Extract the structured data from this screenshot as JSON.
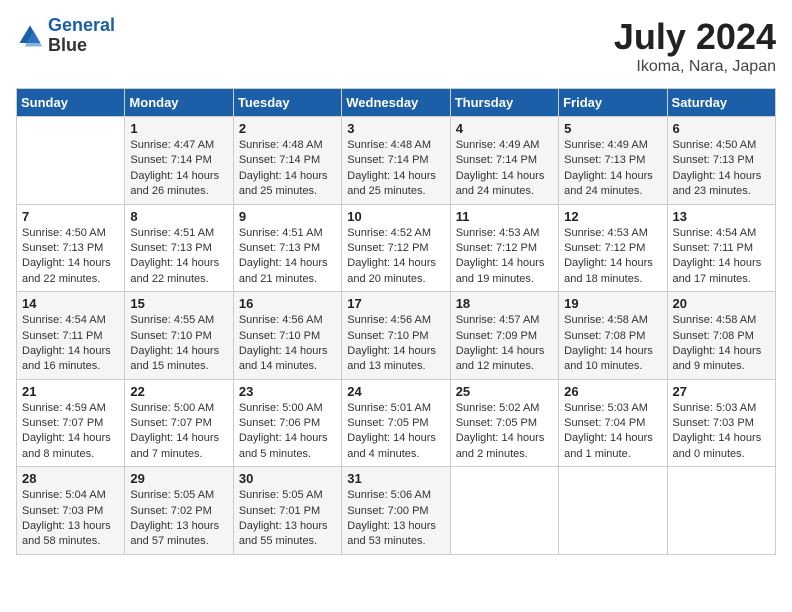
{
  "logo": {
    "line1": "General",
    "line2": "Blue"
  },
  "title": "July 2024",
  "subtitle": "Ikoma, Nara, Japan",
  "days_header": [
    "Sunday",
    "Monday",
    "Tuesday",
    "Wednesday",
    "Thursday",
    "Friday",
    "Saturday"
  ],
  "weeks": [
    [
      {
        "day": "",
        "info": ""
      },
      {
        "day": "1",
        "info": "Sunrise: 4:47 AM\nSunset: 7:14 PM\nDaylight: 14 hours\nand 26 minutes."
      },
      {
        "day": "2",
        "info": "Sunrise: 4:48 AM\nSunset: 7:14 PM\nDaylight: 14 hours\nand 25 minutes."
      },
      {
        "day": "3",
        "info": "Sunrise: 4:48 AM\nSunset: 7:14 PM\nDaylight: 14 hours\nand 25 minutes."
      },
      {
        "day": "4",
        "info": "Sunrise: 4:49 AM\nSunset: 7:14 PM\nDaylight: 14 hours\nand 24 minutes."
      },
      {
        "day": "5",
        "info": "Sunrise: 4:49 AM\nSunset: 7:13 PM\nDaylight: 14 hours\nand 24 minutes."
      },
      {
        "day": "6",
        "info": "Sunrise: 4:50 AM\nSunset: 7:13 PM\nDaylight: 14 hours\nand 23 minutes."
      }
    ],
    [
      {
        "day": "7",
        "info": "Sunrise: 4:50 AM\nSunset: 7:13 PM\nDaylight: 14 hours\nand 22 minutes."
      },
      {
        "day": "8",
        "info": "Sunrise: 4:51 AM\nSunset: 7:13 PM\nDaylight: 14 hours\nand 22 minutes."
      },
      {
        "day": "9",
        "info": "Sunrise: 4:51 AM\nSunset: 7:13 PM\nDaylight: 14 hours\nand 21 minutes."
      },
      {
        "day": "10",
        "info": "Sunrise: 4:52 AM\nSunset: 7:12 PM\nDaylight: 14 hours\nand 20 minutes."
      },
      {
        "day": "11",
        "info": "Sunrise: 4:53 AM\nSunset: 7:12 PM\nDaylight: 14 hours\nand 19 minutes."
      },
      {
        "day": "12",
        "info": "Sunrise: 4:53 AM\nSunset: 7:12 PM\nDaylight: 14 hours\nand 18 minutes."
      },
      {
        "day": "13",
        "info": "Sunrise: 4:54 AM\nSunset: 7:11 PM\nDaylight: 14 hours\nand 17 minutes."
      }
    ],
    [
      {
        "day": "14",
        "info": "Sunrise: 4:54 AM\nSunset: 7:11 PM\nDaylight: 14 hours\nand 16 minutes."
      },
      {
        "day": "15",
        "info": "Sunrise: 4:55 AM\nSunset: 7:10 PM\nDaylight: 14 hours\nand 15 minutes."
      },
      {
        "day": "16",
        "info": "Sunrise: 4:56 AM\nSunset: 7:10 PM\nDaylight: 14 hours\nand 14 minutes."
      },
      {
        "day": "17",
        "info": "Sunrise: 4:56 AM\nSunset: 7:10 PM\nDaylight: 14 hours\nand 13 minutes."
      },
      {
        "day": "18",
        "info": "Sunrise: 4:57 AM\nSunset: 7:09 PM\nDaylight: 14 hours\nand 12 minutes."
      },
      {
        "day": "19",
        "info": "Sunrise: 4:58 AM\nSunset: 7:08 PM\nDaylight: 14 hours\nand 10 minutes."
      },
      {
        "day": "20",
        "info": "Sunrise: 4:58 AM\nSunset: 7:08 PM\nDaylight: 14 hours\nand 9 minutes."
      }
    ],
    [
      {
        "day": "21",
        "info": "Sunrise: 4:59 AM\nSunset: 7:07 PM\nDaylight: 14 hours\nand 8 minutes."
      },
      {
        "day": "22",
        "info": "Sunrise: 5:00 AM\nSunset: 7:07 PM\nDaylight: 14 hours\nand 7 minutes."
      },
      {
        "day": "23",
        "info": "Sunrise: 5:00 AM\nSunset: 7:06 PM\nDaylight: 14 hours\nand 5 minutes."
      },
      {
        "day": "24",
        "info": "Sunrise: 5:01 AM\nSunset: 7:05 PM\nDaylight: 14 hours\nand 4 minutes."
      },
      {
        "day": "25",
        "info": "Sunrise: 5:02 AM\nSunset: 7:05 PM\nDaylight: 14 hours\nand 2 minutes."
      },
      {
        "day": "26",
        "info": "Sunrise: 5:03 AM\nSunset: 7:04 PM\nDaylight: 14 hours\nand 1 minute."
      },
      {
        "day": "27",
        "info": "Sunrise: 5:03 AM\nSunset: 7:03 PM\nDaylight: 14 hours\nand 0 minutes."
      }
    ],
    [
      {
        "day": "28",
        "info": "Sunrise: 5:04 AM\nSunset: 7:03 PM\nDaylight: 13 hours\nand 58 minutes."
      },
      {
        "day": "29",
        "info": "Sunrise: 5:05 AM\nSunset: 7:02 PM\nDaylight: 13 hours\nand 57 minutes."
      },
      {
        "day": "30",
        "info": "Sunrise: 5:05 AM\nSunset: 7:01 PM\nDaylight: 13 hours\nand 55 minutes."
      },
      {
        "day": "31",
        "info": "Sunrise: 5:06 AM\nSunset: 7:00 PM\nDaylight: 13 hours\nand 53 minutes."
      },
      {
        "day": "",
        "info": ""
      },
      {
        "day": "",
        "info": ""
      },
      {
        "day": "",
        "info": ""
      }
    ]
  ]
}
